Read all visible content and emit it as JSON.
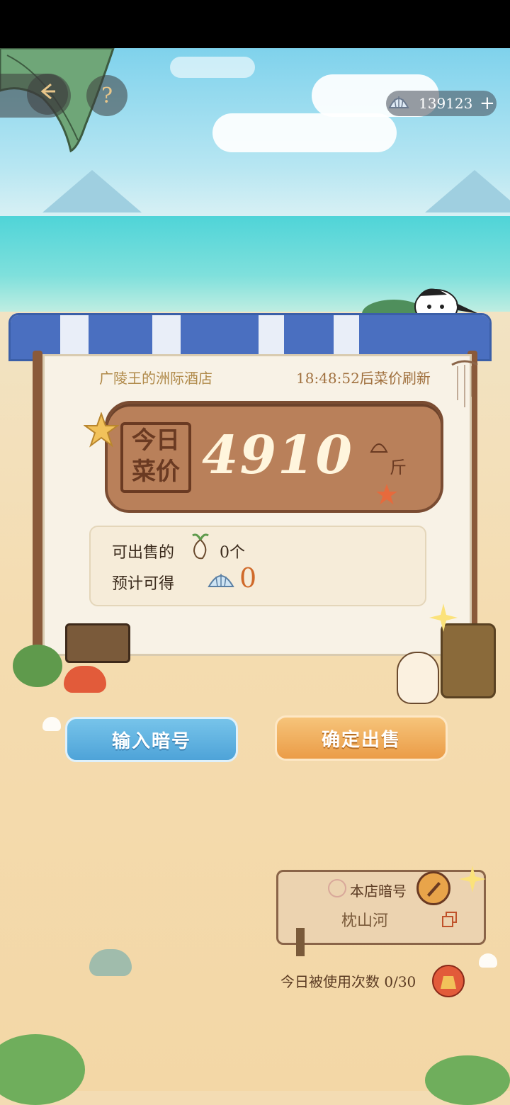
{
  "topbar": {
    "back_icon": "back-arrow-icon",
    "help_label": "?",
    "currency": {
      "icon": "shell-currency-icon",
      "value": "139123",
      "add_label": "+"
    }
  },
  "board": {
    "shop_name": "广陵王的洲际酒店",
    "refresh_notice": "18:48:52后菜价刷新",
    "stamp_line1": "今日",
    "stamp_line2": "菜价",
    "price": "4910",
    "unit": "斤"
  },
  "info": {
    "sellable_label": "可出售的",
    "sellable_count": "0个",
    "expected_label": "预计可得",
    "expected_value": "0"
  },
  "buttons": {
    "enter_code": "输入暗号",
    "confirm_sell": "确定出售"
  },
  "shop_code": {
    "title": "本店暗号",
    "code": "枕山河",
    "usage": "今日被使用次数 0/30"
  },
  "colors": {
    "sky": "#7fd2ec",
    "sea": "#4fd4d8",
    "sand": "#f3d7a6",
    "awning_blue": "#3b5fa8",
    "plank": "#b9805a",
    "blue_button": "#4ea3d8",
    "orange_button": "#eb9c47"
  }
}
